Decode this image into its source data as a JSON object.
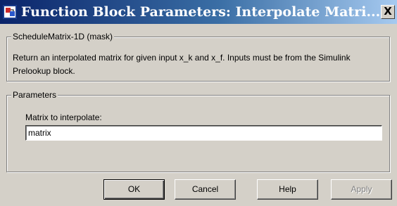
{
  "window": {
    "title": "Function Block Parameters: Interpolate Matri...",
    "app_icon": "simulink-block-icon",
    "close_label": "X"
  },
  "mask_group": {
    "legend": "ScheduleMatrix-1D (mask)",
    "description": "Return an interpolated matrix for given input x_k and x_f. Inputs must be from the Simulink Prelookup block."
  },
  "parameters_group": {
    "legend": "Parameters",
    "matrix_label": "Matrix to interpolate:",
    "matrix_value": "matrix"
  },
  "buttons": {
    "ok": "OK",
    "cancel": "Cancel",
    "help": "Help",
    "apply": "Apply"
  },
  "colors": {
    "title_gradient_start": "#0a246a",
    "title_gradient_end": "#a6caf0",
    "dialog_background": "#d4d0c8"
  }
}
